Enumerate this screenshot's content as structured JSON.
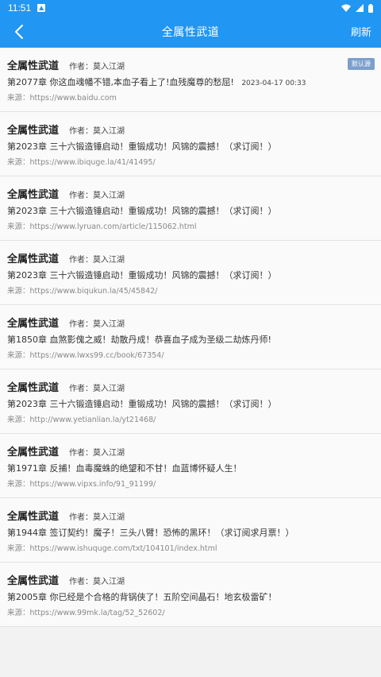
{
  "status": {
    "time": "11:51"
  },
  "appbar": {
    "title": "全属性武道",
    "refresh_label": "刷新"
  },
  "author_label": "作者：",
  "source_label": "来源：",
  "badge_label": "默认源",
  "items": [
    {
      "title": "全属性武道",
      "author": "莫入江湖",
      "chapter": "第2077章 你这血魂幡不错,本血子看上了!血残魔尊的愁屈!",
      "time": "2023-04-17 00:33",
      "source": "https://www.baidu.com",
      "is_default": true
    },
    {
      "title": "全属性武道",
      "author": "莫入江湖",
      "chapter": "第2023章 三十六锻造锤启动！重锻成功！风锦的震撼！（求订阅！）",
      "time": "",
      "source": "https://www.ibiquge.la/41/41495/"
    },
    {
      "title": "全属性武道",
      "author": "莫入江湖",
      "chapter": "第2023章 三十六锻造锤启动！重锻成功！风锦的震撼！（求订阅！）",
      "time": "",
      "source": "https://www.lyruan.com/article/115062.html"
    },
    {
      "title": "全属性武道",
      "author": "莫入江湖",
      "chapter": "第2023章 三十六锻造锤启动！重锻成功！风锦的震撼！（求订阅！）",
      "time": "",
      "source": "https://www.biqukun.la/45/45842/"
    },
    {
      "title": "全属性武道",
      "author": "莫入江湖",
      "chapter": "第1850章 血煞影傀之威！劫散丹成！恭喜血子成为圣级二劫炼丹师!",
      "time": "",
      "source": "https://www.lwxs99.cc/book/67354/"
    },
    {
      "title": "全属性武道",
      "author": "莫入江湖",
      "chapter": "第2023章 三十六锻造锤启动！重锻成功！风锦的震撼！（求订阅！）",
      "time": "",
      "source": "http://www.yetianlian.la/yt21468/"
    },
    {
      "title": "全属性武道",
      "author": "莫入江湖",
      "chapter": "第1971章 反捕！血毒魔蛛的绝望和不甘！血蓝博怀疑人生！",
      "time": "",
      "source": "https://www.vipxs.info/91_91199/"
    },
    {
      "title": "全属性武道",
      "author": "莫入江湖",
      "chapter": "第1944章 签订契约！魔子！三头八臂！恐怖的黑环！（求订阅求月票！）",
      "time": "",
      "source": "https://www.ishuquge.com/txt/104101/index.html"
    },
    {
      "title": "全属性武道",
      "author": "莫入江湖",
      "chapter": "第2005章 你已经是个合格的背锅侠了！五阶空间晶石！地玄极雷矿！",
      "time": "",
      "source": "https://www.99mk.la/tag/52_52602/"
    }
  ]
}
